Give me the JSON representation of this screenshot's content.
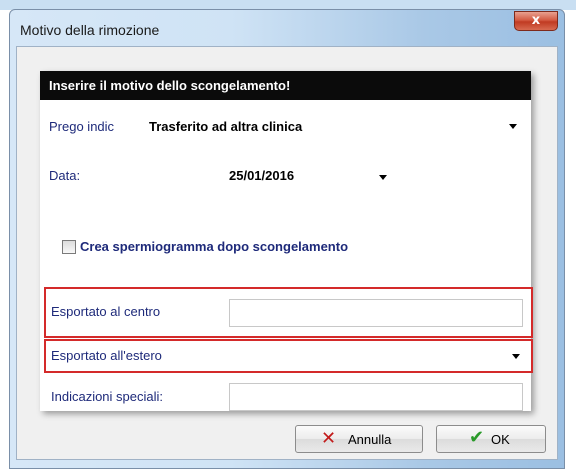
{
  "window": {
    "title": "Motivo della rimozione",
    "close_glyph": "x"
  },
  "panel": {
    "header": "Inserire il motivo dello scongelamento!",
    "reason_label": "Prego indic",
    "reason_value": "Trasferito ad altra clinica",
    "date_label": "Data:",
    "date_value": "25/01/2016",
    "checkbox_label": "Crea spermiogramma dopo scongelamento",
    "checkbox_checked": false,
    "export_center_label": "Esportato al centro",
    "export_center_value": "",
    "export_abroad_label": "Esportato all'estero",
    "export_abroad_value": "",
    "special_label": "Indicazioni speciali:",
    "special_value": ""
  },
  "buttons": {
    "cancel_label": "Annulla",
    "ok_label": "OK",
    "cancel_icon": "x-icon",
    "ok_icon": "checkmark-icon"
  },
  "colors": {
    "header_bg": "#0b0b0b",
    "label_text": "#1e2a7a",
    "highlight_border": "#d42a2a"
  }
}
